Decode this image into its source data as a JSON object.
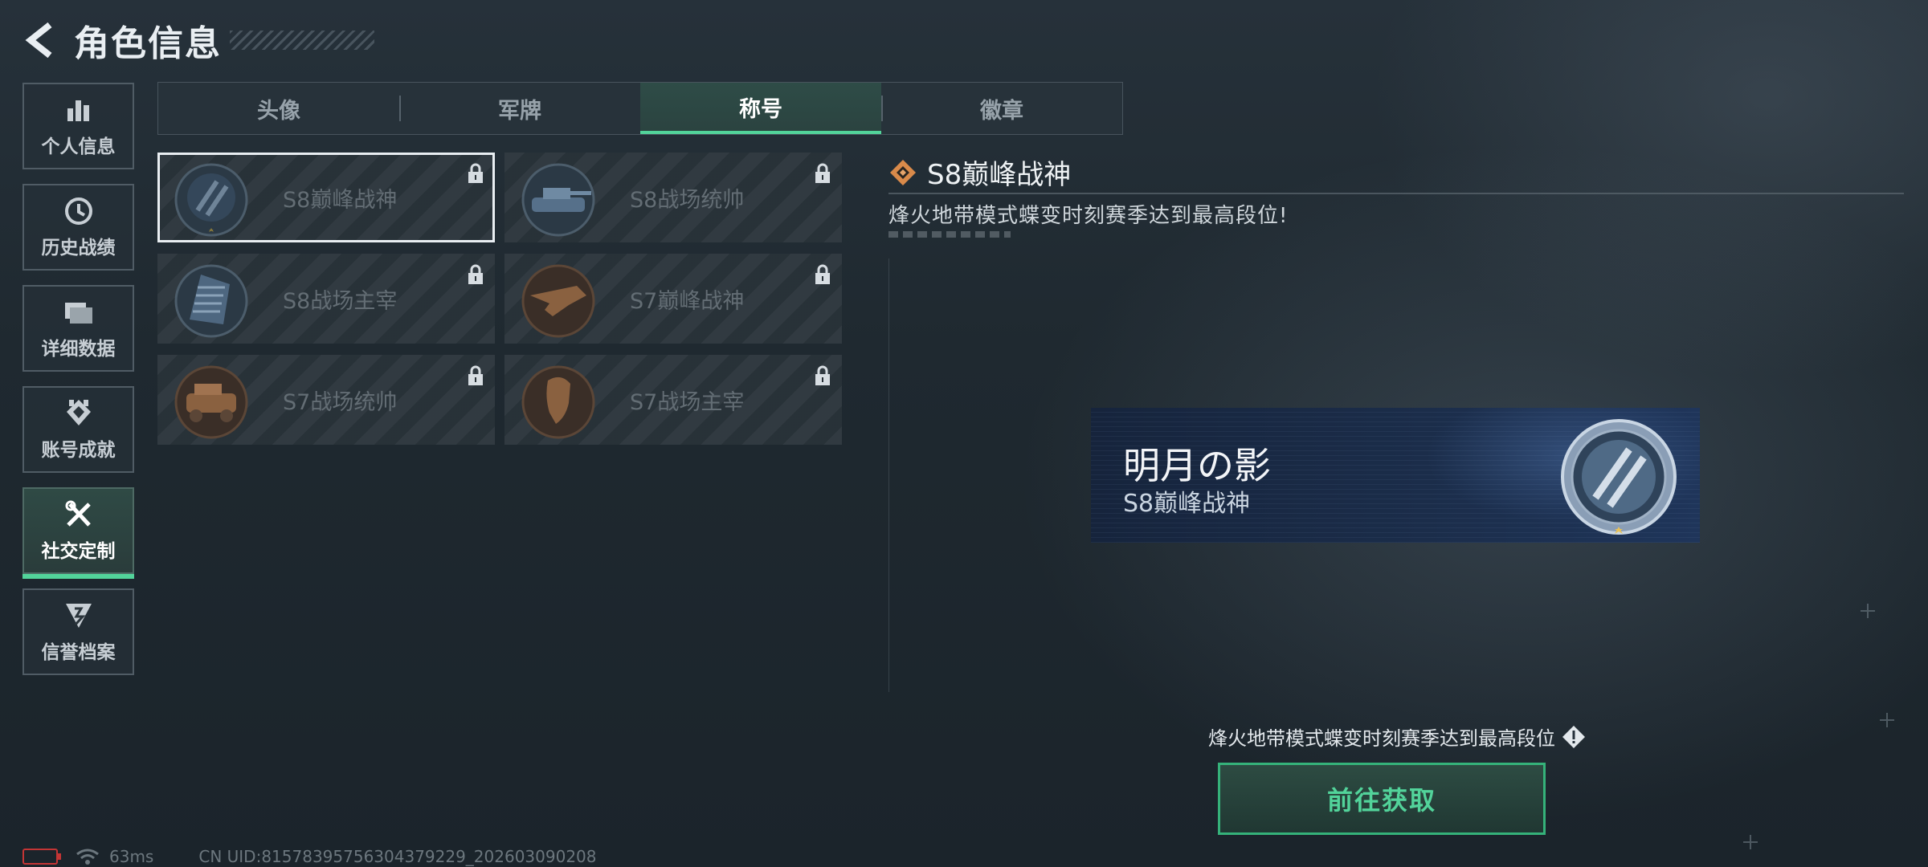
{
  "header": {
    "title": "角色信息"
  },
  "sidenav": [
    {
      "label": "个人信息",
      "icon": "bar-chart-icon",
      "active": false
    },
    {
      "label": "历史战绩",
      "icon": "history-clock-icon",
      "active": false
    },
    {
      "label": "详细数据",
      "icon": "folder-data-icon",
      "active": false
    },
    {
      "label": "账号成就",
      "icon": "achievement-emblem-icon",
      "active": false
    },
    {
      "label": "社交定制",
      "icon": "tools-icon",
      "active": true
    },
    {
      "label": "信誉档案",
      "icon": "credit-shield-icon",
      "active": false
    }
  ],
  "tabs": [
    {
      "label": "头像",
      "active": false
    },
    {
      "label": "军牌",
      "active": false
    },
    {
      "label": "称号",
      "active": true
    },
    {
      "label": "徽章",
      "active": false
    }
  ],
  "titles": [
    {
      "name": "S8巅峰战神",
      "locked": true,
      "selected": true,
      "badge": "blue-slash-emblem"
    },
    {
      "name": "S8战场统帅",
      "locked": true,
      "selected": false,
      "badge": "blue-tank-emblem"
    },
    {
      "name": "S8战场主宰",
      "locked": true,
      "selected": false,
      "badge": "blue-building-emblem"
    },
    {
      "name": "S7巅峰战神",
      "locked": true,
      "selected": false,
      "badge": "bronze-rifle-emblem"
    },
    {
      "name": "S7战场统帅",
      "locked": true,
      "selected": false,
      "badge": "bronze-vehicle-emblem"
    },
    {
      "name": "S7战场主宰",
      "locked": true,
      "selected": false,
      "badge": "bronze-soldier-emblem"
    }
  ],
  "detail": {
    "title": "S8巅峰战神",
    "description": "烽火地带模式蝶变时刻赛季达到最高段位!",
    "preview": {
      "player_name": "明月の影",
      "title": "S8巅峰战神"
    },
    "requirement": "烽火地带模式蝶变时刻赛季达到最高段位",
    "action_label": "前往获取"
  },
  "status": {
    "ping": "63ms",
    "uid": "CN UID:815783957563043792​29_202603090208"
  },
  "colors": {
    "accent": "#52d39a",
    "locked_text": "#636d74",
    "banner": "#1b2d4a"
  }
}
